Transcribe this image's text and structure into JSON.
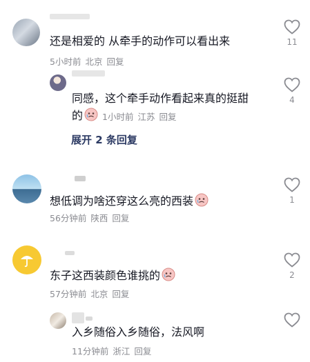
{
  "comments": [
    {
      "text": "还是相爱的 从牵手的动作可以看出来",
      "time": "5小时前",
      "location": "北京",
      "reply_label": "回复",
      "likes": "11"
    },
    {
      "text_line1": "同感，这个牵手动作看起来真的挺甜",
      "text_line2": "的",
      "emoji": "tearful-emoji",
      "time": "1小时前",
      "location": "江苏",
      "reply_label": "回复",
      "likes": "4"
    },
    {
      "text": "想低调为啥还穿这么亮的西装",
      "emoji": "tearful-emoji",
      "time": "56分钟前",
      "location": "陕西",
      "reply_label": "回复",
      "likes": "1"
    },
    {
      "text": "东子这西装颜色谁挑的",
      "emoji": "tearful-emoji",
      "time": "57分钟前",
      "location": "北京",
      "reply_label": "回复",
      "likes": "2"
    },
    {
      "text": "入乡随俗入乡随俗，法风啊",
      "time": "11分钟前",
      "location": "浙江",
      "reply_label": "回复",
      "likes": ""
    }
  ],
  "expand_replies": "展开 2 条回复",
  "colors": {
    "text": "#161823",
    "meta": "#8a8b91",
    "expand": "#2c3a63",
    "heart_outline": "#8a8b91"
  }
}
